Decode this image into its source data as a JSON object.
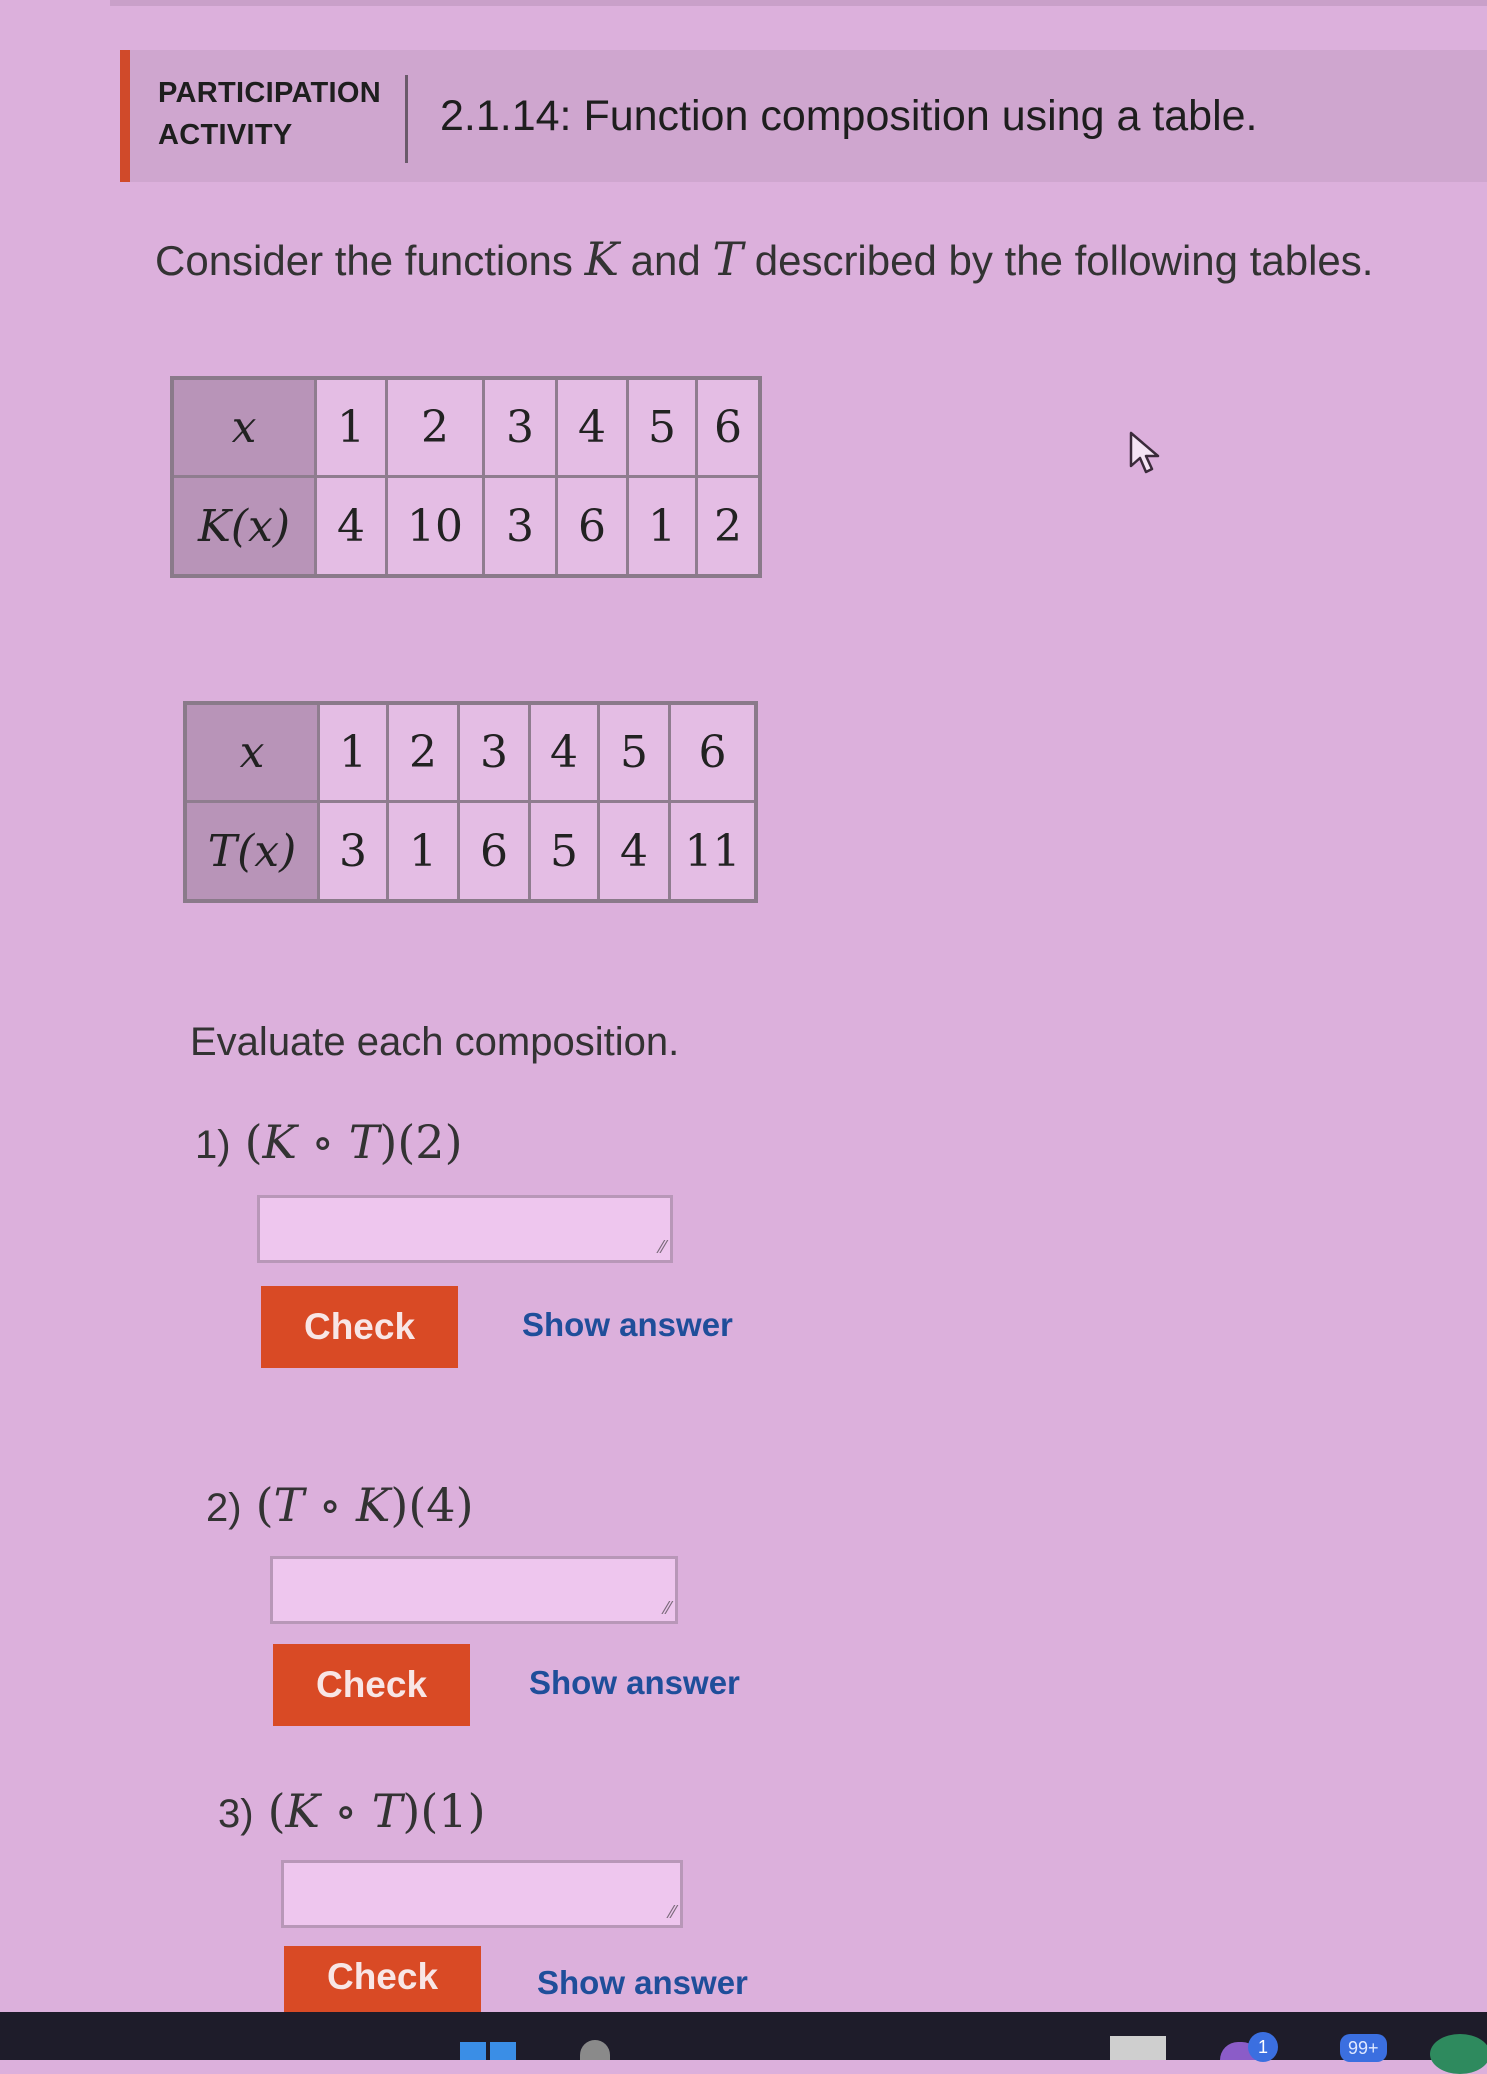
{
  "activity": {
    "label_line1": "PARTICIPATION",
    "label_line2": "ACTIVITY",
    "title": "2.1.14: Function composition using a table."
  },
  "intro": {
    "text_before": "Consider the functions ",
    "func1": "K",
    "text_middle": " and ",
    "func2": "T",
    "text_after": " described by the following tables."
  },
  "table_K": {
    "x_header": "x",
    "f_header": "K(x)",
    "x_values": [
      "1",
      "2",
      "3",
      "4",
      "5",
      "6"
    ],
    "f_values": [
      "4",
      "10",
      "3",
      "6",
      "1",
      "2"
    ]
  },
  "table_T": {
    "x_header": "x",
    "f_header": "T(x)",
    "x_values": [
      "1",
      "2",
      "3",
      "4",
      "5",
      "6"
    ],
    "f_values": [
      "3",
      "1",
      "6",
      "5",
      "4",
      "11"
    ]
  },
  "evaluate_text": "Evaluate each composition.",
  "questions": [
    {
      "number": "1)",
      "outer": "K",
      "inner": "T",
      "arg": "2",
      "answer_value": "",
      "check_label": "Check",
      "show_label": "Show answer"
    },
    {
      "number": "2)",
      "outer": "T",
      "inner": "K",
      "arg": "4",
      "answer_value": "",
      "check_label": "Check",
      "show_label": "Show answer"
    },
    {
      "number": "3)",
      "outer": "K",
      "inner": "T",
      "arg": "1",
      "answer_value": "",
      "check_label": "Check",
      "show_label": "Show answer"
    }
  ],
  "taskbar": {
    "badge_1": "1",
    "badge_2": "99+"
  },
  "colors": {
    "accent_bar": "#d04a2a",
    "check_button": "#d94a25",
    "link": "#1f4e9a"
  }
}
